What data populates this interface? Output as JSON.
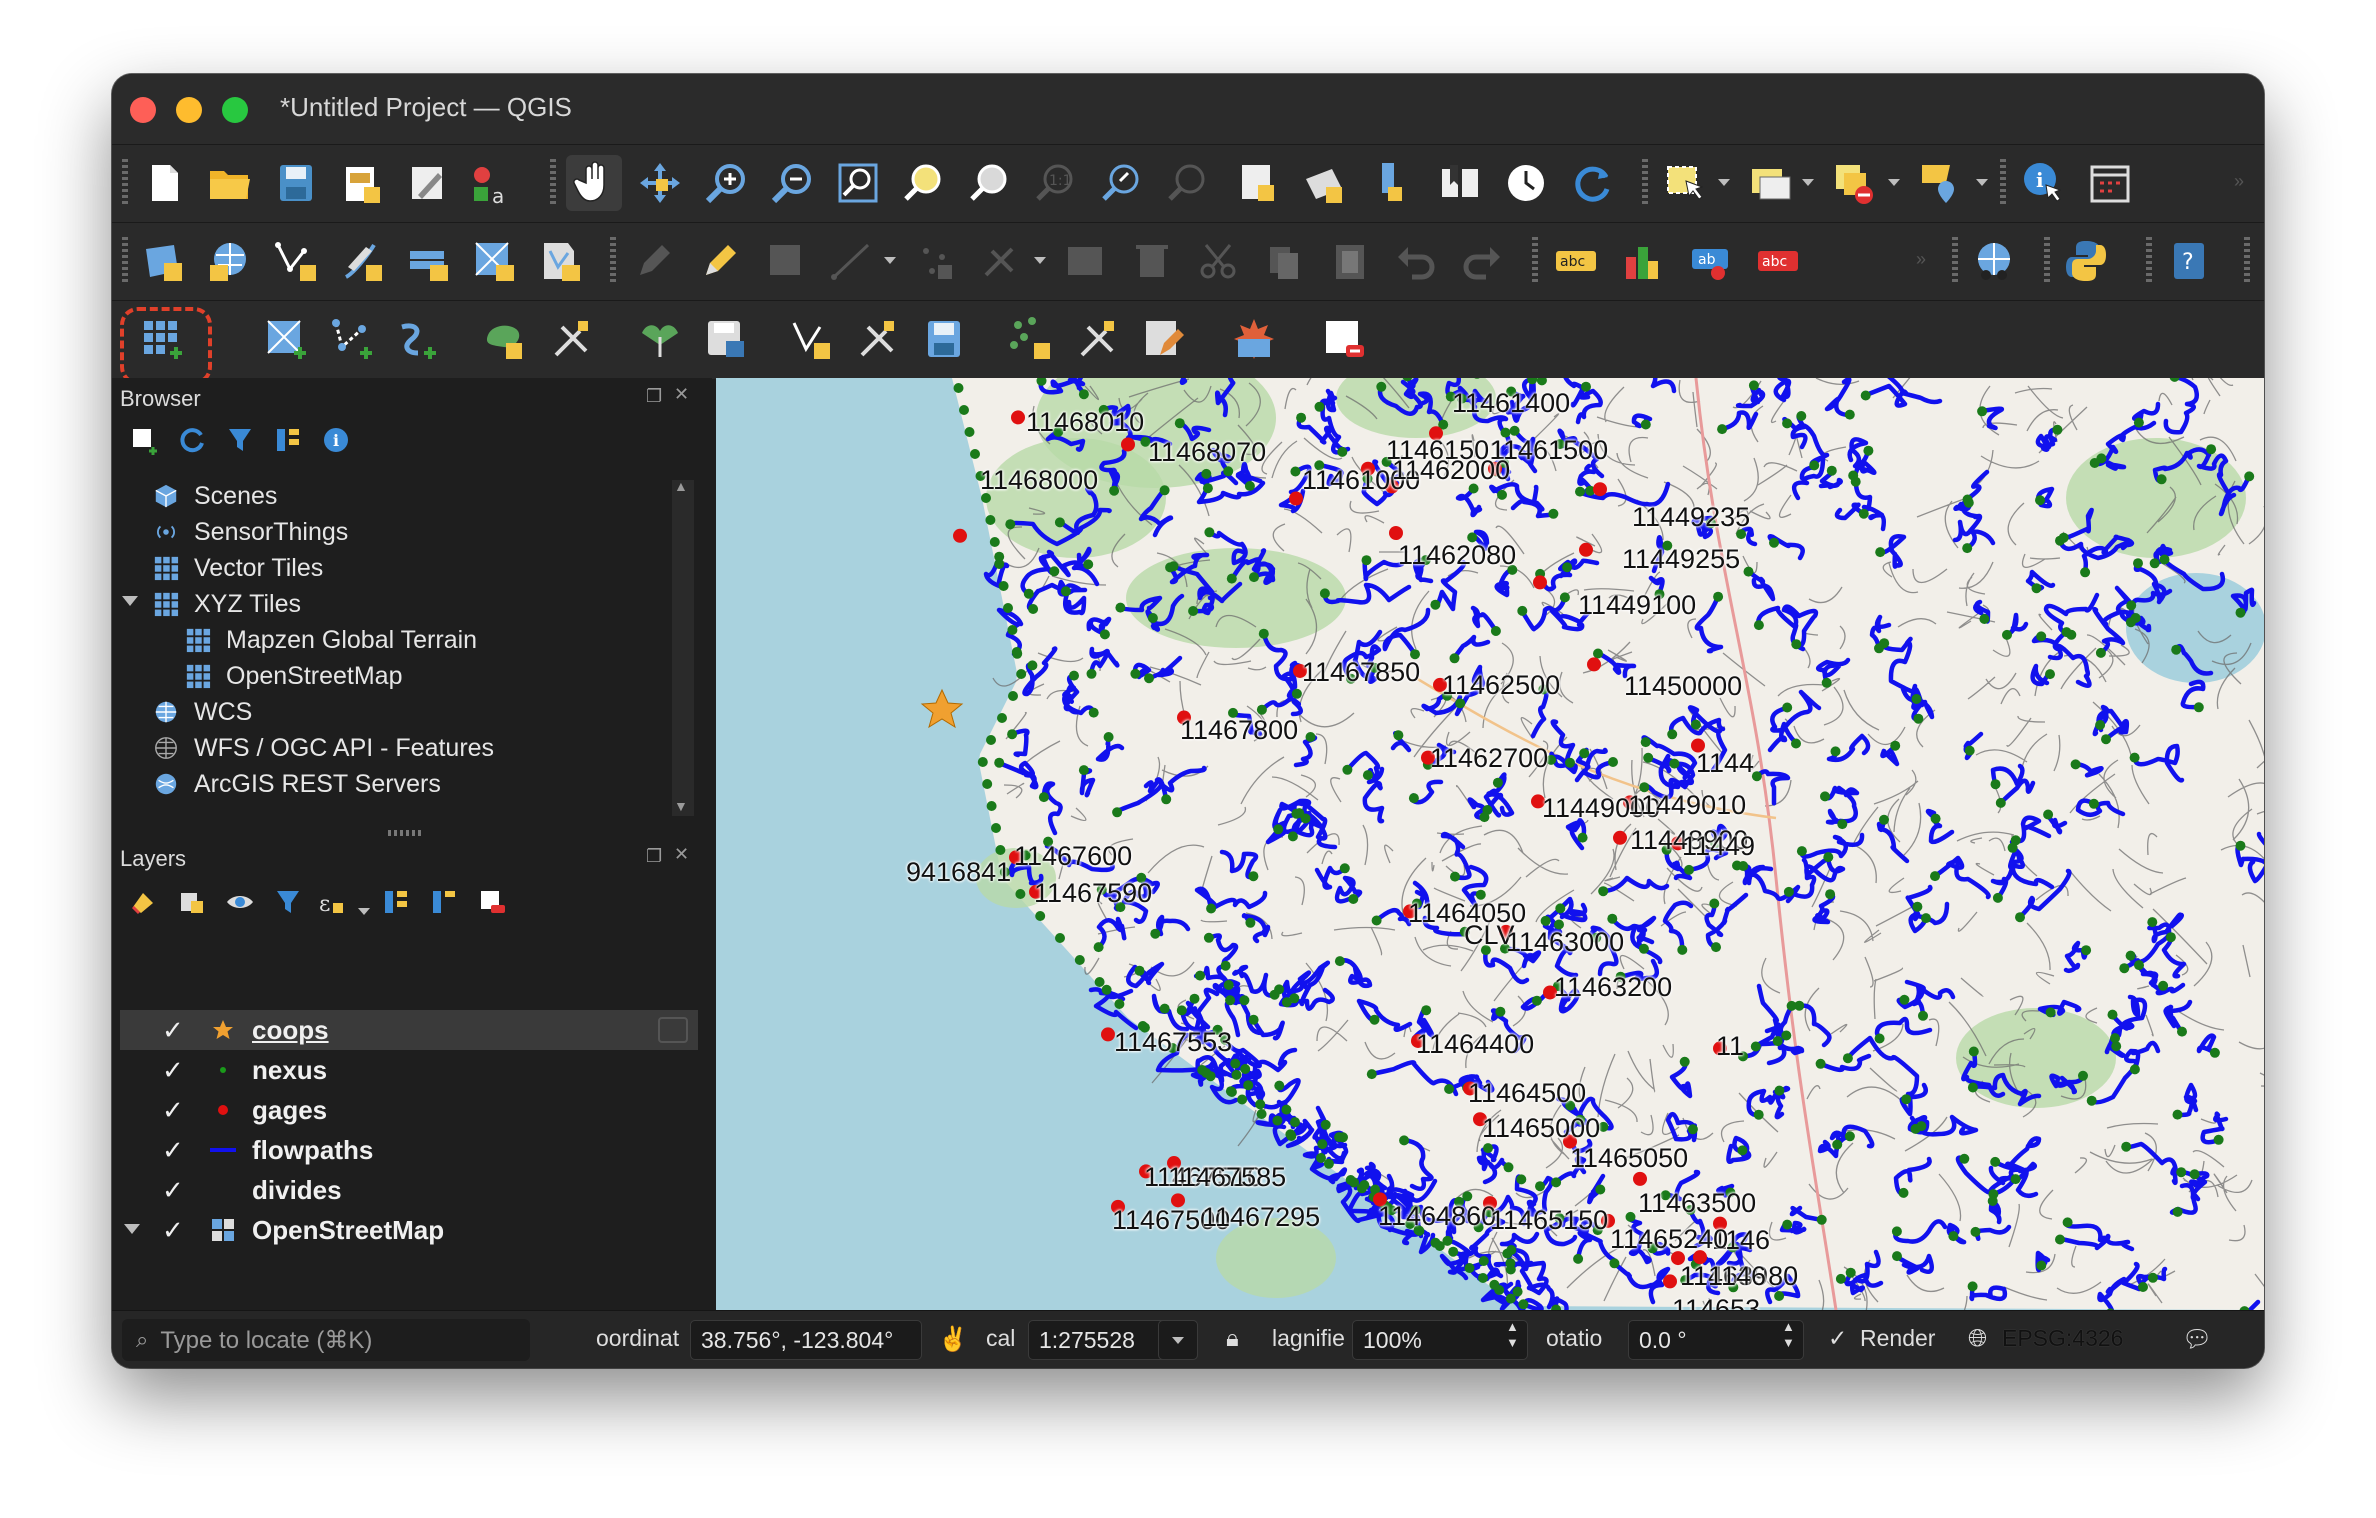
{
  "window": {
    "title": "*Untitled Project — QGIS"
  },
  "colors": {
    "accent_highlight": "#e0402a",
    "flowpath": "#1111ee",
    "nexus": "#1a7a1a",
    "gage": "#e01010",
    "water": "#a9d2de",
    "land": "#f2efe9"
  },
  "toolbars": {
    "row1": [
      "new-project-icon",
      "open-project-icon",
      "save-project-icon",
      "print-layout-icon",
      "layout-manager-icon",
      "style-manager-icon",
      "pan-icon",
      "pan-to-selection-icon",
      "zoom-in-icon",
      "zoom-out-icon",
      "zoom-full-icon",
      "zoom-to-selection-icon",
      "zoom-to-layer-icon",
      "zoom-native-icon",
      "zoom-last-icon",
      "zoom-next-icon",
      "new-bookmark-icon",
      "show-bookmarks-icon",
      "spatial-bookmark-icon",
      "map-tips-icon",
      "temporal-controller-icon",
      "refresh-icon",
      "select-features-icon",
      "attribute-table-icon",
      "deselect-icon",
      "annotation-icon",
      "identify-icon",
      "measure-icon"
    ],
    "row2": [
      "data-source-manager-icon",
      "new-geopackage-icon",
      "new-shapefile-icon",
      "digitize-icon",
      "virtual-layer-icon",
      "new-memory-layer-icon",
      "new-spatialite-icon",
      "editing-toggle-icon",
      "pencil-icon",
      "save-edits-icon",
      "add-feature-icon",
      "vertex-tool-icon",
      "move-feature-icon",
      "delete-selected-icon",
      "cut-icon",
      "copy-icon",
      "paste-icon",
      "undo-icon",
      "redo-icon",
      "label-abc-icon",
      "diagram-icon",
      "label-pin-icon",
      "label-hide-icon",
      "plugins-globe-icon",
      "python-icon",
      "help-icon"
    ],
    "row3": [
      "add-xyz-layer-icon",
      "add-wms-layer-icon",
      "add-vector-layer-icon",
      "add-point-cloud-icon",
      "add-mesh-layer-icon",
      "processing-icon",
      "join-icon",
      "save-layer-icon",
      "vector-edit-icon",
      "attribute-edit-icon",
      "save-edit-icon",
      "point-edit-icon",
      "measure-edit-icon",
      "form-edit-icon",
      "plugin-icon",
      "remove-layer-icon"
    ]
  },
  "browser": {
    "title": "Browser",
    "items": [
      {
        "label": "Scenes",
        "indent": 0
      },
      {
        "label": "SensorThings",
        "indent": 0
      },
      {
        "label": "Vector Tiles",
        "indent": 0
      },
      {
        "label": "XYZ Tiles",
        "indent": 0,
        "expanded": true
      },
      {
        "label": "Mapzen Global Terrain",
        "indent": 1
      },
      {
        "label": "OpenStreetMap",
        "indent": 1
      },
      {
        "label": "WCS",
        "indent": 0
      },
      {
        "label": "WFS / OGC API - Features",
        "indent": 0
      },
      {
        "label": "ArcGIS REST Servers",
        "indent": 0
      }
    ]
  },
  "layers": {
    "title": "Layers",
    "items": [
      {
        "name": "coops",
        "checked": true,
        "selected": true
      },
      {
        "name": "nexus",
        "checked": true
      },
      {
        "name": "gages",
        "checked": true
      },
      {
        "name": "flowpaths",
        "checked": true
      },
      {
        "name": "divides",
        "checked": true
      },
      {
        "name": "OpenStreetMap",
        "checked": true,
        "expanded": true
      }
    ]
  },
  "map": {
    "labels": [
      {
        "text": "11468010"
      },
      {
        "text": "11461400"
      },
      {
        "text": "11468070"
      },
      {
        "text": "11461501"
      },
      {
        "text": "11461500"
      },
      {
        "text": "11461000"
      },
      {
        "text": "11462000"
      },
      {
        "text": "11449235"
      },
      {
        "text": "11468000"
      },
      {
        "text": "11449255"
      },
      {
        "text": "11462080"
      },
      {
        "text": "11449100"
      },
      {
        "text": "11450000"
      },
      {
        "text": "11467850"
      },
      {
        "text": "11462500"
      },
      {
        "text": "11467800"
      },
      {
        "text": "11462700"
      },
      {
        "text": "1144"
      },
      {
        "text": "11449000"
      },
      {
        "text": "11449010"
      },
      {
        "text": "9416841"
      },
      {
        "text": "11467600"
      },
      {
        "text": "11448900"
      },
      {
        "text": "11449"
      },
      {
        "text": "11467590"
      },
      {
        "text": "11464050"
      },
      {
        "text": "CLV"
      },
      {
        "text": "11463000"
      },
      {
        "text": "11463200"
      },
      {
        "text": "11467553"
      },
      {
        "text": "11464400"
      },
      {
        "text": "11"
      },
      {
        "text": "11464500"
      },
      {
        "text": "11465000"
      },
      {
        "text": "11465050"
      },
      {
        "text": "11467510"
      },
      {
        "text": "11467585"
      },
      {
        "text": "11463500"
      },
      {
        "text": "11467500"
      },
      {
        "text": "11467295"
      },
      {
        "text": "11464860"
      },
      {
        "text": "11465150"
      },
      {
        "text": "1146"
      },
      {
        "text": "11465240"
      },
      {
        "text": "11463980"
      },
      {
        "text": "1146"
      },
      {
        "text": "114653"
      }
    ]
  },
  "statusbar": {
    "locator_placeholder": "Type to locate (⌘K)",
    "coordinate_label": "oordinat",
    "coordinate_value": "38.756°, -123.804°",
    "scale_label": "cal",
    "scale_value": "1:275528",
    "magnifier_label": "lagnifie",
    "magnifier_value": "100%",
    "rotation_label": "otatio",
    "rotation_value": "0.0 °",
    "render_label": "Render",
    "crs_label": "EPSG:4326"
  }
}
